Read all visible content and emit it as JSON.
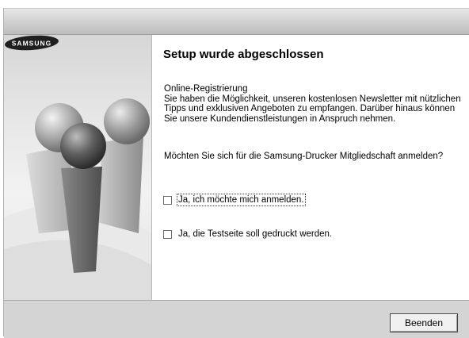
{
  "content": {
    "heading": "Setup wurde abgeschlossen",
    "paragraph_lines": [
      "Online-Registrierung",
      "Sie haben die Möglichkeit, unseren kostenlosen Newsletter mit nützlichen",
      "Tipps und exklusiven Angeboten zu empfangen. Darüber hinaus können",
      "Sie unsere Kundendienstleistungen in Anspruch nehmen."
    ],
    "question": "Möchten Sie sich für die Samsung-Drucker Mitgliedschaft anmelden?",
    "options": [
      {
        "label": "Ja, ich möchte mich anmelden.",
        "checked": false,
        "focused": true
      },
      {
        "label": "Ja, die Testseite soll gedruckt werden.",
        "checked": false,
        "focused": false
      }
    ]
  },
  "left_panel": {
    "logo_text": "SAMSUNG",
    "sphere_colors": [
      "#8a8a8a",
      "#5c5c5c",
      "#b4b4b4"
    ]
  },
  "footer": {
    "finish_label": "Beenden"
  }
}
